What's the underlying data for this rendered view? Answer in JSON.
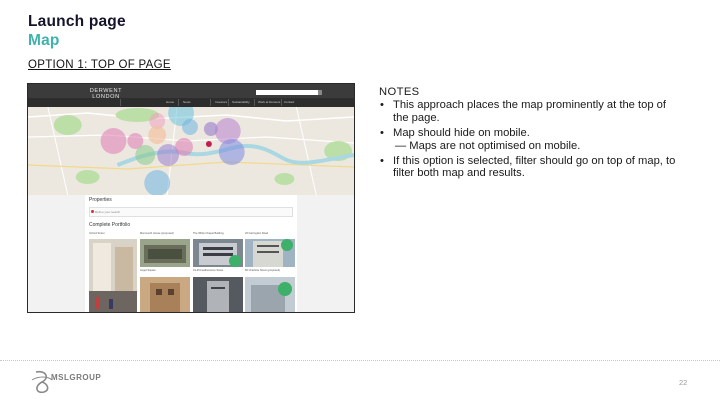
{
  "slide": {
    "title": "Launch page",
    "subtitle": "Map",
    "option": "OPTION 1: TOP OF PAGE",
    "page_number": "22",
    "accent_color": "#3db3ac"
  },
  "notes": {
    "heading": "NOTES",
    "items": [
      "This approach places the map prominently at the top of the page.",
      "Map should hide on mobile.",
      "If this option is selected, filter should go on top of map, to filter both map and results."
    ],
    "subitem": "— Maps are not optimised on mobile."
  },
  "mockup": {
    "logo_line1": "DERWENT",
    "logo_line2": "LONDON",
    "nav": [
      "Home",
      "News",
      "Investors",
      "Sustainability",
      "Work at Derwent",
      "Contact"
    ],
    "properties_heading": "Properties",
    "filter_label": "Refine your search",
    "portfolio_heading": "Complete Portfolio",
    "properties": [
      "Oxford Street",
      "Monmouth House (proposed)",
      "The White Chapel Building",
      "20 Farringdon Road",
      "Angel Square",
      "19-25 Featherstone Street",
      "80 Charlotte Street (proposed)"
    ]
  },
  "footer": {
    "brand": "MSLGROUP",
    "logo_icon": "msl-swirl-icon"
  }
}
